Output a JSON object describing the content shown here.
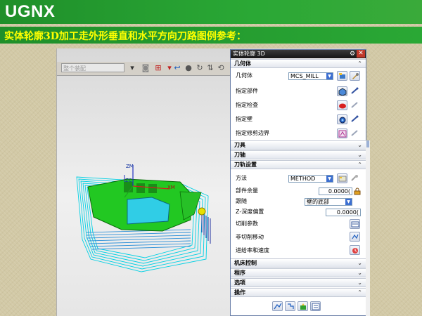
{
  "slide": {
    "title": "UGNX",
    "subtitle": "实体轮廓3D加工走外形垂直和水平方向刀路图例参考："
  },
  "viewport": {
    "dropdown_value": "整个装配",
    "axes": {
      "z": "ZM",
      "x": "XM",
      "z_wcs": "ZC"
    }
  },
  "dialog": {
    "title": "实体轮廓 3D",
    "sections": {
      "geometry": "几何体",
      "tool": "刀具",
      "tool_axis": "刀轴",
      "path_settings": "刀轨设置",
      "machine_control": "机床控制",
      "program": "程序",
      "options": "选项",
      "actions": "操作"
    },
    "geometry": {
      "geometry_label": "几何体",
      "geometry_value": "MCS_MILL",
      "specify_part": "指定部件",
      "specify_check": "指定检查",
      "specify_wall": "指定壁",
      "specify_trim": "指定修剪边界"
    },
    "path_settings": {
      "method_label": "方法",
      "method_value": "METHOD",
      "stock_label": "部件余量",
      "stock_value": "0.0000(",
      "follow_label": "跟随",
      "follow_value": "壁的底部",
      "zdepth_label": "Z-深度偏置",
      "zdepth_value": "0.0000(",
      "cut_params": "切削参数",
      "non_cut_moves": "非切削移动",
      "feeds_speeds": "进给率和速度"
    }
  },
  "colors": {
    "title_green": "#2aa835",
    "subtitle_yellow": "#ffff00",
    "part_green": "#1fcf1f",
    "toolpath_cyan": "#00d8e8",
    "floor_cyan": "#30d0e8"
  }
}
